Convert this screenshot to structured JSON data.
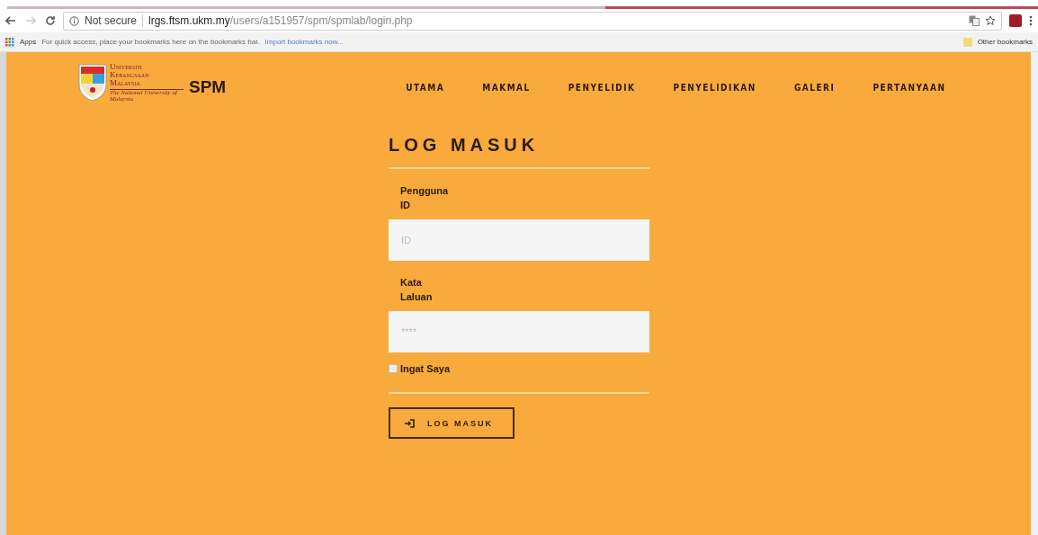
{
  "browser": {
    "security": "Not secure",
    "url_host": "lrgs.ftsm.ukm.my",
    "url_path": "/users/a151957/spm/spmlab/login.php",
    "bookmarks_apps": "Apps",
    "bookmarks_hint": "For quick access, place your bookmarks here on the bookmarks bar.",
    "bookmarks_import": "Import bookmarks now...",
    "other_bookmarks": "Other bookmarks"
  },
  "header": {
    "logo_lines": [
      "Universiti",
      "Kebangsaan",
      "Malaysia"
    ],
    "logo_tagline": "The National University of Malaysia",
    "brand": "SPM",
    "nav": [
      {
        "label": "UTAMA"
      },
      {
        "label": "MAKMAL"
      },
      {
        "label": "PENYELIDIK"
      },
      {
        "label": "PENYELIDIKAN"
      },
      {
        "label": "GALERI"
      },
      {
        "label": "PERTANYAAN"
      }
    ]
  },
  "form": {
    "title": "LOG MASUK",
    "fields": [
      {
        "label": "Pengguna ID",
        "placeholder": "ID"
      },
      {
        "label": "Kata Laluan",
        "placeholder": "****"
      }
    ],
    "remember": {
      "label": "Ingat Saya",
      "checked": false
    },
    "submit": "LOG MASUK"
  }
}
